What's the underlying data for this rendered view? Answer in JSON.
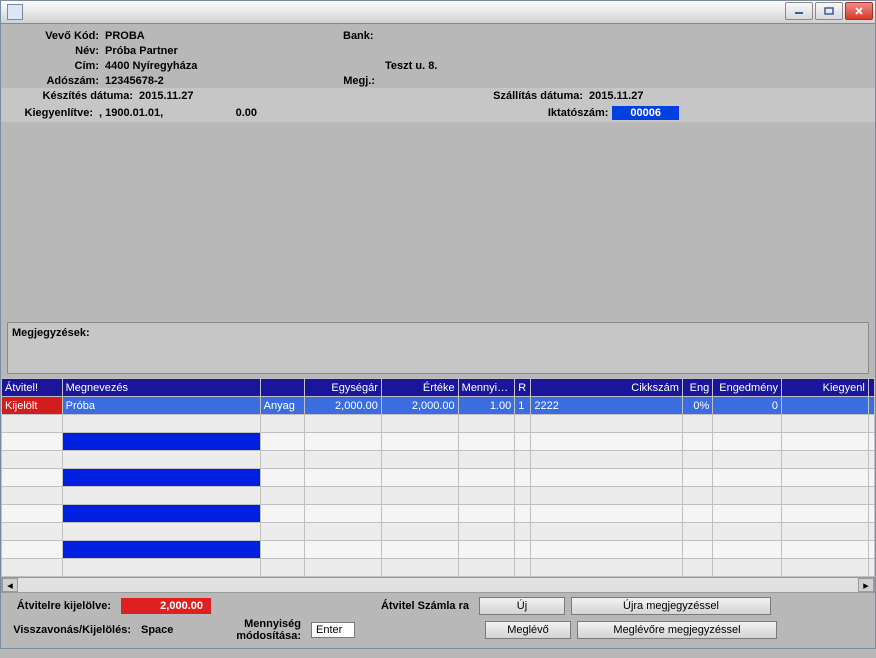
{
  "header": {
    "buyer_code_label": "Vevő  Kód:",
    "buyer_code": "PROBA",
    "bank_label": "Bank:",
    "bank": "",
    "name_label": "Név:",
    "name": "Próba Partner",
    "addr_label": "Cím:",
    "addr_city": "4400 Nyíregyháza",
    "addr_street": "Teszt u. 8.",
    "tax_label": "Adószám:",
    "tax": "12345678-2",
    "made_label": "Készítés dátuma:",
    "made": "2015.11.27",
    "ship_label": "Szállítás dátuma:",
    "ship": "2015.11.27",
    "paid_label": "Kiegyenlítve:",
    "paid_date": ",  1900.01.01,",
    "paid_amount": "0.00",
    "note_label": "Megj.:",
    "regnum_label": "Iktatószám:",
    "regnum": "00006"
  },
  "notes": {
    "title": "Megjegyzések:"
  },
  "grid": {
    "headers": {
      "c0": "Átvitel!",
      "c1": "Megnevezés",
      "c2": "",
      "c3": "Egységár",
      "c4": "Értéke",
      "c5": "Mennyiség",
      "c6": "R",
      "c7": "Cikkszám",
      "c8": "Eng",
      "c9": "Engedmény",
      "c10": "Kiegyenl"
    },
    "row": {
      "c0": "Kijelölt",
      "c1": "Próba",
      "c2": "Anyag",
      "c3": "2,000.00",
      "c4": "2,000.00",
      "c5": "1.00",
      "c6": "1",
      "c7": "2222",
      "c8": "0%",
      "c9": "0",
      "c10": ""
    }
  },
  "footer": {
    "selected_label": "Átvitelre kijelölve:",
    "selected_value": "2,000.00",
    "transfer_label": "Átvitel Számla  ra",
    "new_btn": "Új",
    "new_note_btn": "Újra megjegyzéssel",
    "undo_label": "Visszavonás/Kijelölés:",
    "undo_key": "Space",
    "qty_label": "Mennyiség módosítása:",
    "qty_key": "Enter",
    "existing_btn": "Meglévő",
    "existing_note_btn": "Meglévőre megjegyzéssel"
  }
}
